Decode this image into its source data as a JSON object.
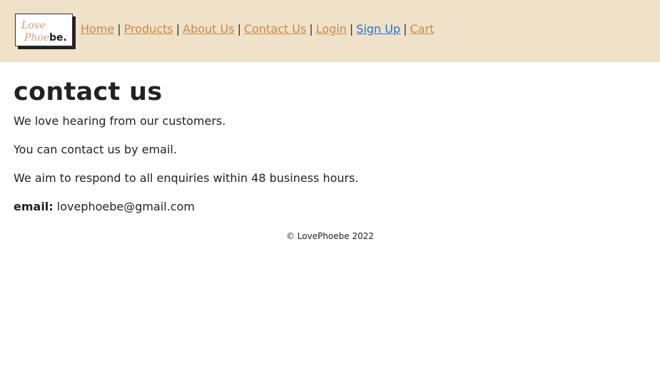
{
  "logo": {
    "text_top": "Love",
    "text_bottom_script": "Phoe",
    "text_bottom_bold": "be."
  },
  "nav": {
    "items": [
      {
        "label": "Home"
      },
      {
        "label": "Products"
      },
      {
        "label": "About Us"
      },
      {
        "label": "Contact Us"
      },
      {
        "label": "Login"
      },
      {
        "label": "Sign Up"
      },
      {
        "label": "Cart"
      }
    ],
    "separator": "|"
  },
  "page": {
    "title": "contact us",
    "paragraphs": [
      "We love hearing from our customers.",
      "You can contact us by email.",
      "We aim to respond to all enquiries within 48 business hours."
    ],
    "email_label": "email:",
    "email_value": "lovephoebe@gmail.com"
  },
  "footer": {
    "text": "© LovePhoebe 2022"
  },
  "colors": {
    "header_bg": "#efe2c8",
    "link": "#c98a4a",
    "link_active": "#2b6fd6"
  }
}
